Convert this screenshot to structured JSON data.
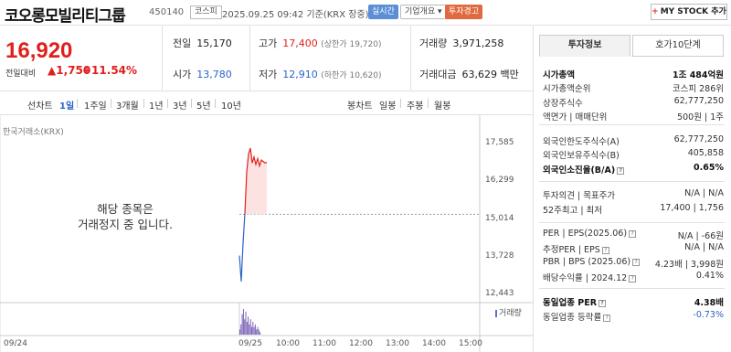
{
  "header": {
    "title": "코오롱모빌리티그룹",
    "code": "450140",
    "market_badge": "코스피",
    "datetime": "2025.09.25 09:42 기준(KRX 장중)",
    "btn_realtime": "실시간",
    "btn_company": "기업개요",
    "btn_company_icon": "chevron-down-icon",
    "btn_recommend": "투자경고",
    "btn_mystock": "MY STOCK 추가",
    "btn_mystock_icon": "+"
  },
  "price": {
    "current": "16,920",
    "change_label": "전일대비",
    "change_value": "1,750",
    "change_icon": "▲",
    "change_pct": "+11.54%"
  },
  "summary": {
    "prev_close": {
      "label": "전일",
      "value": "15,170"
    },
    "open": {
      "label": "시가",
      "value": "13,780"
    },
    "high": {
      "label": "고가",
      "value": "17,400",
      "sub": "(상한가 19,720)"
    },
    "low": {
      "label": "저가",
      "value": "12,910",
      "sub": "(하한가 10,620)"
    },
    "volume": {
      "label": "거래량",
      "value": "3,971,258"
    },
    "trade_value": {
      "label": "거래대금",
      "value": "63,629",
      "unit": "백만"
    }
  },
  "period_bar": {
    "line_chart_label": "선차트",
    "periods": [
      "1일",
      "1주일",
      "3개월",
      "1년",
      "3년",
      "5년",
      "10년"
    ],
    "active_period": "1일",
    "candle_chart_label": "봉차트",
    "candle_periods": [
      "일봉",
      "주봉",
      "월봉"
    ]
  },
  "chart": {
    "exchange_label": "한국거래소(KRX)",
    "halt_message_1": "해당 종목은",
    "halt_message_2": "거래정지 중 입니다.",
    "volume_label": "거래량",
    "y_ticks": [
      "17,585",
      "16,299",
      "15,014",
      "13,728",
      "12,443"
    ],
    "x_ticks": [
      "09/24",
      "09/25",
      "10:00",
      "11:00",
      "12:00",
      "13:00",
      "14:00",
      "15:00"
    ]
  },
  "chart_data": {
    "type": "line",
    "ylim": [
      12443,
      17585
    ],
    "reference_line": 15170,
    "price_series": [
      {
        "t": "09:00",
        "y": 13780
      },
      {
        "t": "09:01",
        "y": 12910
      },
      {
        "t": "09:02",
        "y": 14200
      },
      {
        "t": "09:03",
        "y": 15200
      },
      {
        "t": "09:04",
        "y": 16600
      },
      {
        "t": "09:05",
        "y": 17200
      },
      {
        "t": "09:06",
        "y": 17400
      },
      {
        "t": "09:07",
        "y": 16900
      },
      {
        "t": "09:08",
        "y": 17100
      },
      {
        "t": "09:09",
        "y": 16850
      },
      {
        "t": "09:10",
        "y": 17050
      },
      {
        "t": "09:11",
        "y": 16800
      },
      {
        "t": "09:12",
        "y": 17000
      },
      {
        "t": "09:13",
        "y": 16950
      },
      {
        "t": "09:14",
        "y": 16900
      },
      {
        "t": "09:15",
        "y": 16920
      }
    ],
    "volume_series": [
      2,
      4,
      8,
      10,
      6,
      9,
      5,
      7,
      4,
      6,
      3,
      5,
      3,
      4,
      2,
      3,
      2,
      1
    ]
  },
  "info_panel": {
    "tab_active": "투자정보",
    "tab_other": "호가10단계",
    "rows": [
      {
        "l": "시가총액",
        "r": "1조 484억원",
        "bold": true
      },
      {
        "l": "시가총액순위",
        "r": "코스피 286위"
      },
      {
        "l": "상장주식수",
        "r": "62,777,250"
      },
      {
        "l": "액면가 | 매매단위",
        "r": "500원 | 1주"
      },
      {
        "l": "외국인한도주식수(A)",
        "r": "62,777,250"
      },
      {
        "l": "외국인보유주식수(B)",
        "r": "405,858"
      },
      {
        "l": "외국인소진율(B/A)",
        "r": "0.65%",
        "bold": true,
        "hint": true
      },
      {
        "l": "투자의견 | 목표주가",
        "r": "N/A | N/A"
      },
      {
        "l": "52주최고 | 최저",
        "r": "17,400 | 1,756"
      },
      {
        "l": "PER | EPS(2025.06)",
        "r": "N/A | -66원",
        "hint": true
      },
      {
        "l": "추정PER | EPS",
        "r": "N/A | N/A",
        "hint": true
      },
      {
        "l": "PBR | BPS (2025.06)",
        "r": "4.23배 | 3,998원",
        "hint": true
      },
      {
        "l": "배당수익률 | 2024.12",
        "r": "0.41%",
        "hint": true
      },
      {
        "l": "동일업종 PER",
        "r": "4.38배",
        "bold": true,
        "hint": true
      },
      {
        "l": "동일업종 등락률",
        "r": "-0.73%",
        "blue": true,
        "hint": true
      }
    ]
  },
  "colors": {
    "up": "#e0201c",
    "down": "#2a63c9",
    "volume": "#7a62b8",
    "fill_up": "#fde2e2"
  }
}
